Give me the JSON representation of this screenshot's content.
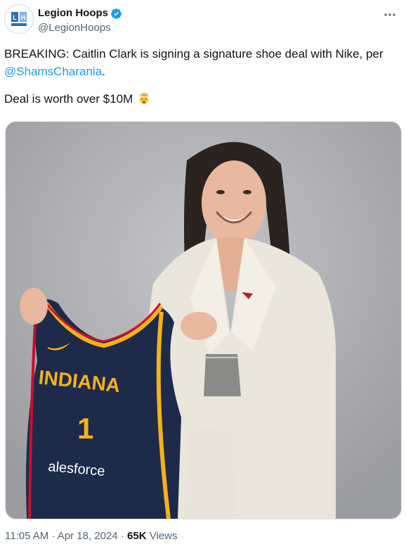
{
  "tweet": {
    "author": {
      "display_name": "Legion Hoops",
      "handle": "@LegionHoops",
      "verified": true,
      "avatar_icon": "legion-hoops-logo"
    },
    "more_icon": "more-dots-icon",
    "text": {
      "line1_before": "BREAKING: Caitlin Clark is signing a signature shoe deal with Nike, per ",
      "mention": "@ShamsCharania",
      "line1_after": ".",
      "line2": "Deal is worth over $10M",
      "emoji": "exploding-head-emoji"
    },
    "media": {
      "jersey_text": "INDIANA",
      "jersey_number": "1",
      "jersey_sponsor": "alesforce"
    },
    "meta": {
      "time": "11:05 AM",
      "separator": " · ",
      "date": "Apr 18, 2024",
      "views_count": "65K",
      "views_label": " Views"
    },
    "colors": {
      "link": "#1d9bf0",
      "secondary_text": "#536471",
      "verified": "#1d9bf0"
    }
  }
}
